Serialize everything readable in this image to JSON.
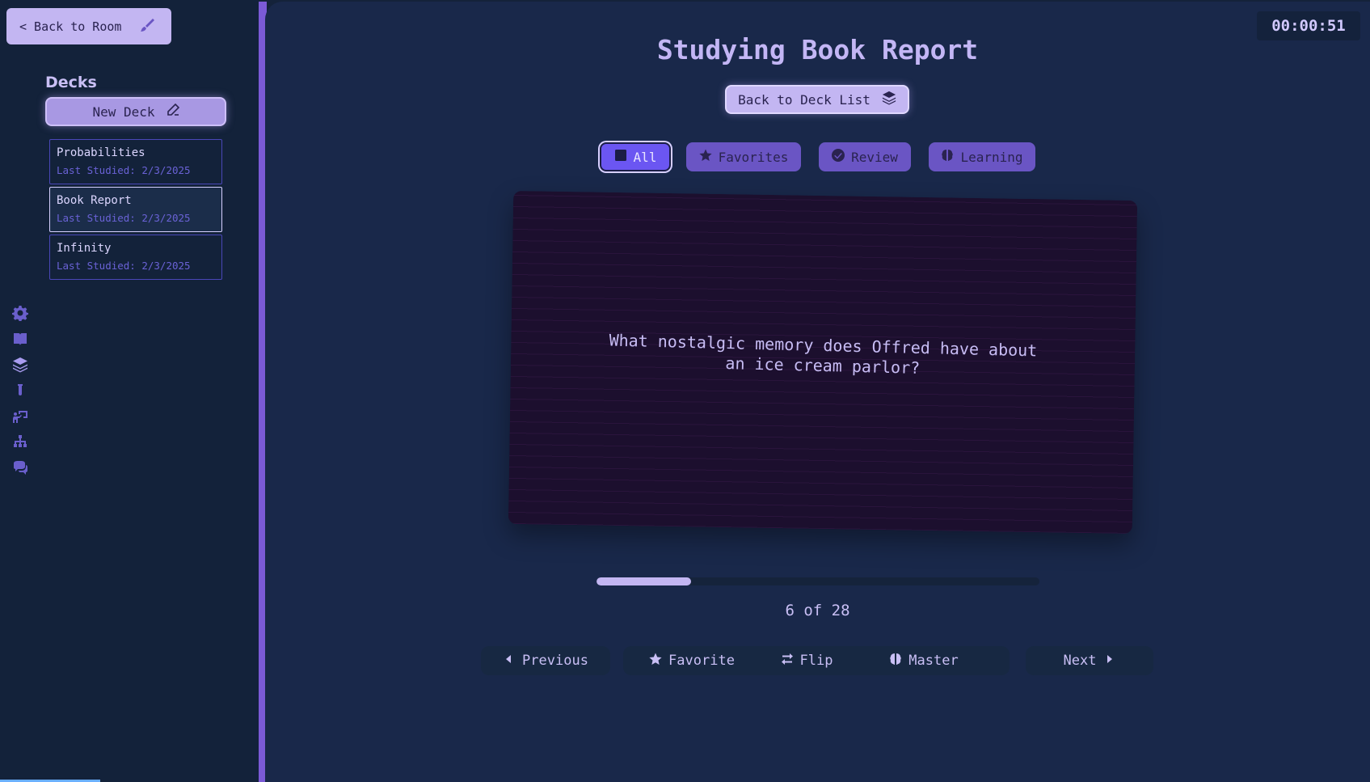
{
  "sidebar": {
    "back_label": "< Back to Room",
    "decks_title": "Decks",
    "new_deck_label": "New Deck",
    "decks": [
      {
        "name": "Probabilities",
        "last_studied": "Last Studied: 2/3/2025",
        "active": false
      },
      {
        "name": "Book Report",
        "last_studied": "Last Studied: 2/3/2025",
        "active": true
      },
      {
        "name": "Infinity",
        "last_studied": "Last Studied: 2/3/2025",
        "active": false
      }
    ],
    "icons": [
      "gear-icon",
      "book-icon",
      "layers-icon",
      "flask-icon",
      "presentation-icon",
      "sitemap-icon",
      "comments-icon"
    ]
  },
  "main": {
    "timer": "00:00:51",
    "title": "Studying Book Report",
    "back_deck_label": "Back to Deck List",
    "filters": [
      {
        "label": "All",
        "icon": "square-icon",
        "active": true
      },
      {
        "label": "Favorites",
        "icon": "star-icon",
        "active": false
      },
      {
        "label": "Review",
        "icon": "check-circle-icon",
        "active": false
      },
      {
        "label": "Learning",
        "icon": "brain-icon",
        "active": false
      }
    ],
    "card_text": "What nostalgic memory does Offred have about an ice cream parlor?",
    "progress": {
      "current": 6,
      "total": 28,
      "label": "6 of 28"
    },
    "controls": {
      "previous": "Previous",
      "favorite": "Favorite",
      "flip": "Flip",
      "master": "Master",
      "next": "Next"
    }
  },
  "colors": {
    "accent": "#7b5ad6",
    "button_light": "#c3b6f2",
    "background": "#19284a",
    "card": "#1c0f2e"
  }
}
